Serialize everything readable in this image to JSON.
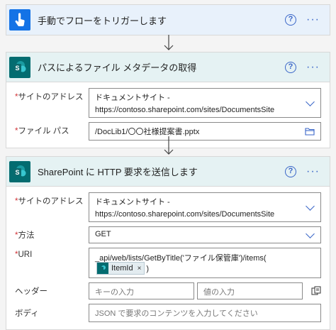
{
  "trigger": {
    "title": "手動でフローをトリガーします",
    "help": "?",
    "more": "···"
  },
  "action1": {
    "title": "パスによるファイル メタデータの取得",
    "help": "?",
    "more": "···",
    "site_label": "サイトのアドレス",
    "site_value_line1": "ドキュメントサイト -",
    "site_value_line2": "https://contoso.sharepoint.com/sites/DocumentsSite",
    "path_label": "ファイル パス",
    "path_value": "/DocLib1/〇〇社様提案書.pptx"
  },
  "action2": {
    "title": "SharePoint に HTTP 要求を送信します",
    "help": "?",
    "more": "···",
    "site_label": "サイトのアドレス",
    "site_value_line1": "ドキュメントサイト -",
    "site_value_line2": "https://contoso.sharepoint.com/sites/DocumentsSite",
    "method_label": "方法",
    "method_value": "GET",
    "uri_label": "URI",
    "uri_prefix": "_api/web/lists/GetByTitle('ファイル保管庫')/items(",
    "uri_token": "ItemId",
    "uri_token_close": "×",
    "uri_suffix": ")",
    "header_label": "ヘッダー",
    "header_key_placeholder": "キーの入力",
    "header_value_placeholder": "値の入力",
    "body_label": "ボディ",
    "body_placeholder": "JSON で要求のコンテンツを入力してください"
  },
  "required_mark": "*",
  "colors": {
    "accent": "#3a66c8",
    "manual_icon": "#1473e6",
    "sharepoint": "#036c70",
    "required": "#d13438"
  }
}
